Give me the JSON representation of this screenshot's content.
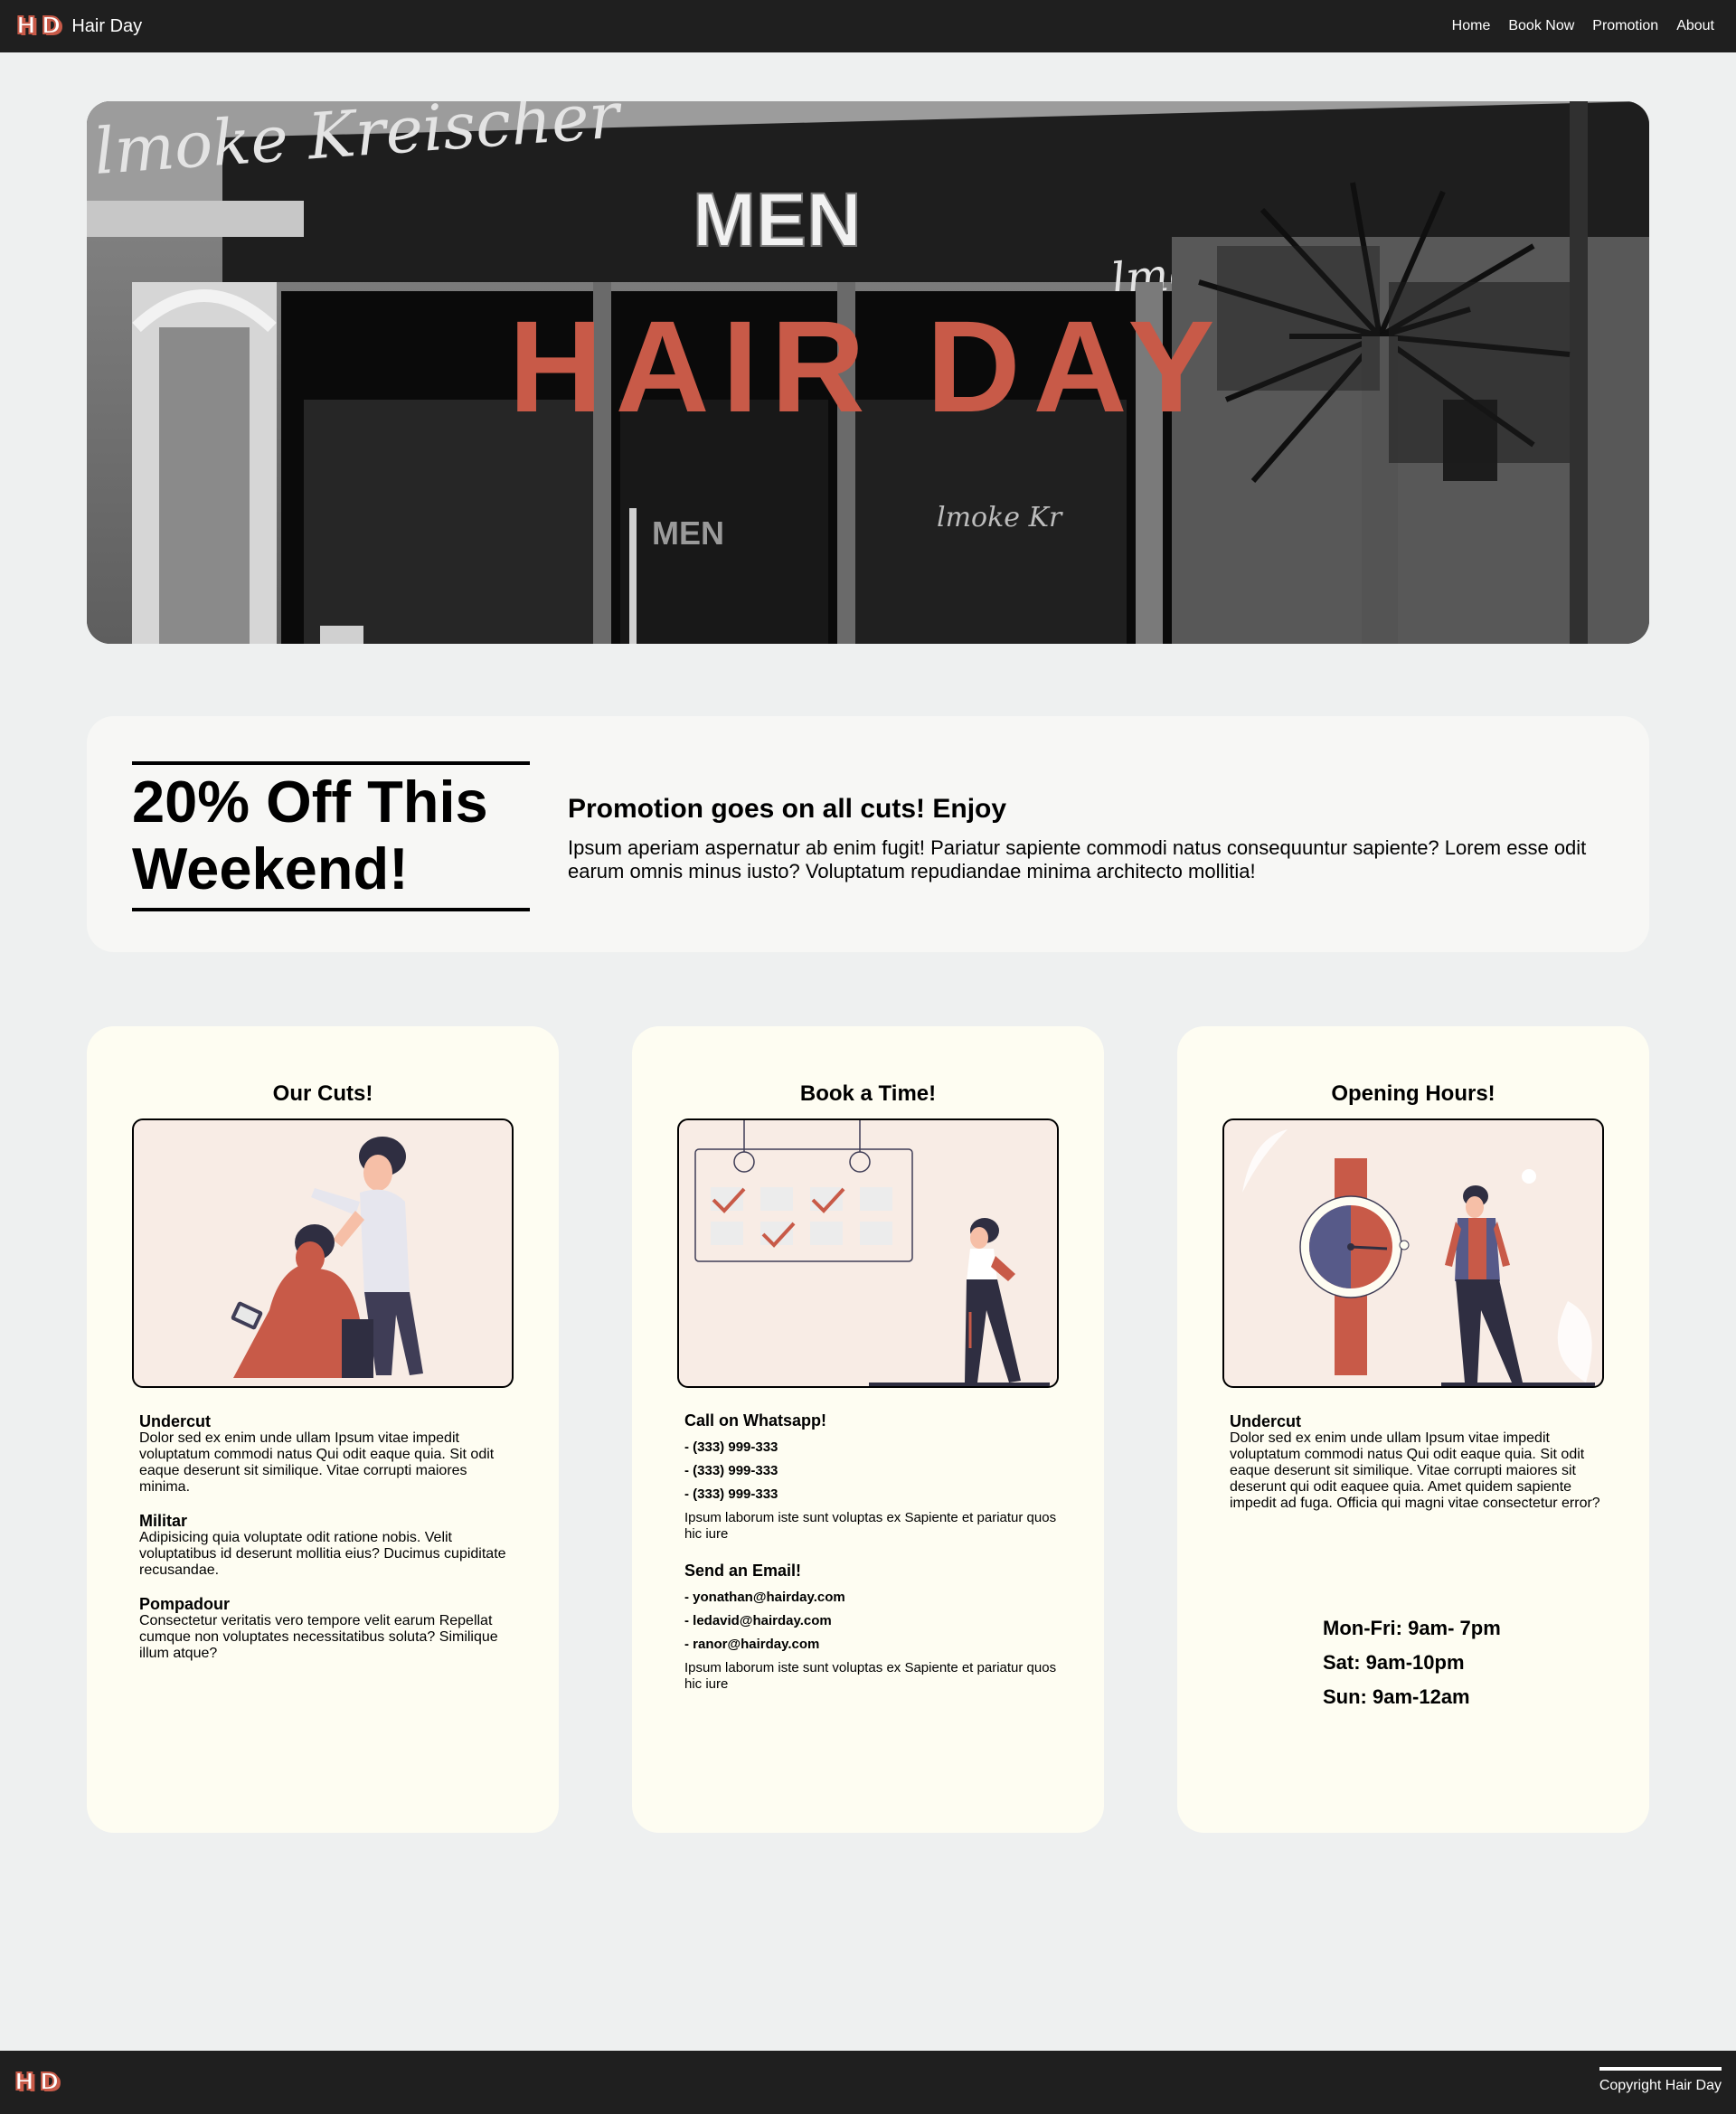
{
  "header": {
    "logo_letters": [
      "H",
      "D"
    ],
    "brand": "Hair Day",
    "nav": [
      "Home",
      "Book Now",
      "Promotion",
      "About"
    ]
  },
  "hero": {
    "title": "HAIR DAY",
    "sign_text": "MEN"
  },
  "promotion": {
    "heading": "20% Off This Weekend!",
    "subheading": "Promotion goes on all cuts! Enjoy",
    "text": "Ipsum aperiam aspernatur ab enim fugit! Pariatur sapiente commodi natus consequuntur sapiente? Lorem esse odit earum omnis minus iusto? Voluptatum repudiandae minima architecto mollitia!"
  },
  "cards": {
    "cuts": {
      "title": "Our Cuts!",
      "items": [
        {
          "name": "Undercut",
          "text": "Dolor sed ex enim unde ullam Ipsum vitae impedit voluptatum commodi natus Qui odit eaque quia. Sit odit eaque deserunt sit similique. Vitae corrupti maiores minima."
        },
        {
          "name": "Militar",
          "text": "Adipisicing quia voluptate odit ratione nobis. Velit voluptatibus id deserunt mollitia eius? Ducimus cupiditate recusandae."
        },
        {
          "name": "Pompadour",
          "text": "Consectetur veritatis vero tempore velit earum Repellat cumque non voluptates necessitatibus soluta? Similique illum atque?"
        }
      ]
    },
    "book": {
      "title": "Book a Time!",
      "whatsapp_title": "Call on Whatsapp!",
      "phones": [
        "- (333) 999-333",
        "- (333) 999-333",
        "- (333) 999-333"
      ],
      "whatsapp_note": "Ipsum laborum iste sunt voluptas ex Sapiente et pariatur quos hic iure",
      "email_title": "Send an Email!",
      "emails": [
        "- yonathan@hairday.com",
        "- ledavid@hairday.com",
        "- ranor@hairday.com"
      ],
      "email_note": "Ipsum laborum iste sunt voluptas ex Sapiente et pariatur quos hic iure"
    },
    "hours": {
      "title": "Opening Hours!",
      "item_name": "Undercut",
      "item_text": "Dolor sed ex enim unde ullam Ipsum vitae impedit voluptatum commodi natus Qui odit eaque quia. Sit odit eaque deserunt sit similique. Vitae corrupti maiores sit deserunt qui odit eaquee quia. Amet quidem sapiente impedit ad fuga. Officia qui magni vitae consectetur error?",
      "schedule": [
        "Mon-Fri: 9am- 7pm",
        "Sat: 9am-10pm",
        "Sun: 9am-12am"
      ]
    }
  },
  "footer": {
    "copyright": "Copyright Hair Day"
  },
  "colors": {
    "accent": "#c85a48",
    "dark": "#1f1f1f",
    "navy": "#3f3d56",
    "background": "#eef0f0",
    "card": "#fefdf2"
  }
}
